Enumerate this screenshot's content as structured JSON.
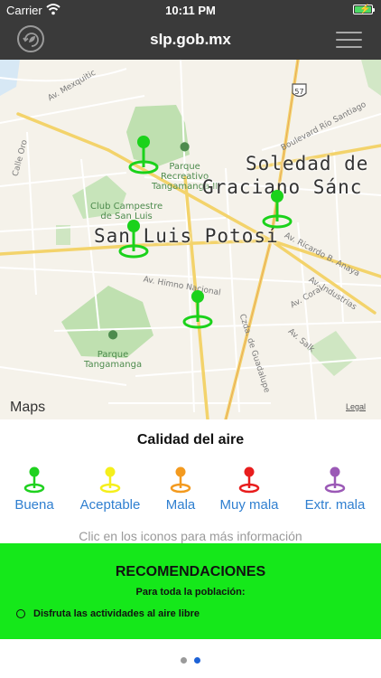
{
  "status_bar": {
    "carrier": "Carrier",
    "time": "10:11 PM",
    "icons": [
      "wifi-icon",
      "battery-charging-icon"
    ]
  },
  "nav": {
    "title": "slp.gob.mx",
    "left_icon": "refresh-leaf-icon",
    "right_icon": "hamburger-menu-icon"
  },
  "map": {
    "cities": [
      "Soledad de",
      "Graciano Sánc",
      "San Luis Potosí"
    ],
    "parks": [
      "Parque\nRecreativo\nTangamanga II",
      "Club Campestre\nde San Luis",
      "Parque\nTangamanga"
    ],
    "streets": [
      "Av. Mexquitic",
      "Calle Oro",
      "Boulevard Río Santiago",
      "Av. Ricardo B. Anaya",
      "Av. Industrias",
      "Av. Coral",
      "Av. Himno Nacional",
      "Czda. de Guadalupe",
      "Av. Salk"
    ],
    "highway_shield": "57",
    "attribution": "Maps",
    "legal": "Legal",
    "marker_color": "#1bd21b",
    "marker_count": 4
  },
  "legend": {
    "title": "Calidad del aire",
    "items": [
      {
        "label": "Buena",
        "color": "#1fd11f"
      },
      {
        "label": "Aceptable",
        "color": "#f5ef1c"
      },
      {
        "label": "Mala",
        "color": "#f39a1f"
      },
      {
        "label": "Muy mala",
        "color": "#e81d1d"
      },
      {
        "label": "Extr. mala",
        "color": "#9b59b6"
      }
    ],
    "hint": "Clic en los iconos para más información"
  },
  "recommendations": {
    "title": "RECOMENDACIONES",
    "subtitle": "Para toda la población:",
    "items": [
      "Disfruta las actividades al aire libre"
    ],
    "background": "#15e81a"
  },
  "pager": {
    "page": 2,
    "total": 2
  }
}
